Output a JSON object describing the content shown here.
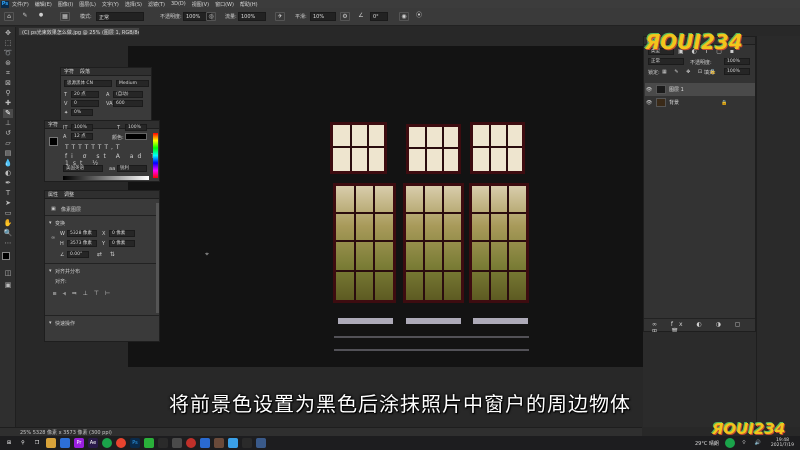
{
  "app": {
    "logo": "Ps"
  },
  "menu": [
    "文件(F)",
    "编辑(E)",
    "图像(I)",
    "图层(L)",
    "文字(Y)",
    "选择(S)",
    "滤镜(T)",
    "3D(D)",
    "视图(V)",
    "窗口(W)",
    "帮助(H)"
  ],
  "options": {
    "mode_label": "模式:",
    "mode_value": "正常",
    "opacity_label": "不透明度:",
    "opacity_value": "100%",
    "flow_label": "流量:",
    "flow_value": "100%",
    "smooth_label": "平滑:",
    "smooth_value": "10%",
    "angle_value": "0°"
  },
  "document_tab": "(C) ps光束效果怎么做.jpg @ 25% (图层 1, RGB/8#) *",
  "character_panel": {
    "tabs": [
      "字符",
      "段落"
    ],
    "font_family": "思源黑体 CN",
    "font_style": "Medium",
    "font_size": "20 点",
    "leading": "(自动)",
    "kerning": "0",
    "tracking": "600",
    "scale_v": "100%",
    "scale_h": "100%",
    "baseline": "12 点",
    "color_label": "颜色:",
    "lang": "美国英语",
    "aa": "锐利",
    "pct": "0%"
  },
  "properties_panel": {
    "tabs": [
      "属性",
      "调整"
    ],
    "pixel_layer": "像素图层",
    "transform": "变换",
    "w_label": "W",
    "w_value": "5328 像素",
    "h_label": "H",
    "h_value": "3573 像素",
    "x_label": "X",
    "x_value": "0 像素",
    "y_label": "Y",
    "y_value": "0 像素",
    "angle": "0.00°",
    "align": "对齐并分布",
    "align_sub": "对齐:",
    "quick": "快速操作"
  },
  "layers_panel": {
    "title": "图层",
    "kind": "类型",
    "blend": "正常",
    "opacity_label": "不透明度:",
    "opacity_value": "100%",
    "lock_label": "锁定:",
    "fill_label": "填充:",
    "fill_value": "100%",
    "layers": [
      {
        "name": "图层 1"
      },
      {
        "name": "背景"
      }
    ]
  },
  "status": "25%   5328 像素 x 3573 像素 (300 ppi)",
  "subtitle": "将前景色设置为黑色后涂抹照片中窗户的周边物体",
  "watermark": "ЯOUI234",
  "taskbar": {
    "clock_time": "19:48",
    "clock_date": "2021/7/19",
    "weather": "29°C 晴朗"
  }
}
